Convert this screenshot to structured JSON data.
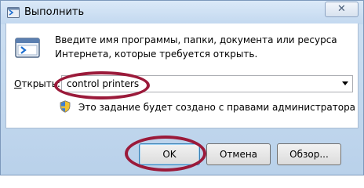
{
  "window": {
    "title": "Выполнить",
    "close_label": "✕"
  },
  "dialog": {
    "description_line1": "Введите имя программы, папки, документа или ресурса",
    "description_line2": "Интернета, которые требуется открыть.",
    "open_label": "Открыть:",
    "open_label_first": "О",
    "open_label_rest": "ткрыть:",
    "command_value": "control printers",
    "admin_note": "Это задание будет создано с правами администратора"
  },
  "buttons": {
    "ok": "OK",
    "cancel": "Отмена",
    "browse": "Обзор..."
  },
  "colors": {
    "highlight": "#9b1a3a"
  }
}
